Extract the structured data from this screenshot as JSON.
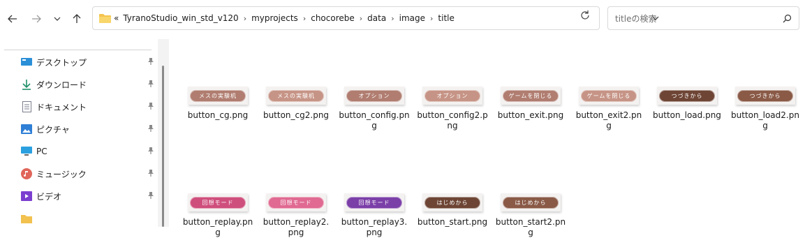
{
  "toolbar": {
    "address_overflow": "«",
    "breadcrumb": [
      "TyranoStudio_win_std_v120",
      "myprojects",
      "chocorebe",
      "data",
      "image",
      "title"
    ],
    "search_placeholder": "titleの検索"
  },
  "sidebar": {
    "items": [
      {
        "label": "デスクトップ",
        "icon": "desktop-icon",
        "color": "#2b8fd8"
      },
      {
        "label": "ダウンロード",
        "icon": "download-icon",
        "color": "#1f8f6a"
      },
      {
        "label": "ドキュメント",
        "icon": "document-icon",
        "color": "#7a7f8c"
      },
      {
        "label": "ピクチャ",
        "icon": "pictures-icon",
        "color": "#2f7fd6"
      },
      {
        "label": "PC",
        "icon": "pc-icon",
        "color": "#2aa0e0"
      },
      {
        "label": "ミュージック",
        "icon": "music-icon",
        "color": "#e0655a"
      },
      {
        "label": "ビデオ",
        "icon": "video-icon",
        "color": "#7b3fd0"
      },
      {
        "label": "",
        "icon": "folder-icon",
        "color": "#f2c14e"
      }
    ]
  },
  "files": [
    {
      "name": "button_cg.png",
      "thumb_text": "メスの実験机",
      "color": "#b07d70"
    },
    {
      "name": "button_cg2.png",
      "thumb_text": "メスの実験机",
      "color": "#c69486"
    },
    {
      "name": "button_config.png",
      "thumb_text": "オプション",
      "color": "#b07d70"
    },
    {
      "name": "button_config2.png",
      "thumb_text": "オプション",
      "color": "#c69486"
    },
    {
      "name": "button_exit.png",
      "thumb_text": "ゲームを閉じる",
      "color": "#b07d70"
    },
    {
      "name": "button_exit2.png",
      "thumb_text": "ゲームを閉じる",
      "color": "#c69486"
    },
    {
      "name": "button_load.png",
      "thumb_text": "つづきから",
      "color": "#6e4535"
    },
    {
      "name": "button_load2.png",
      "thumb_text": "つづきから",
      "color": "#8a5a47"
    },
    {
      "name": "button_replay.png",
      "thumb_text": "回想モード",
      "color": "#cf4f7c"
    },
    {
      "name": "button_replay2.png",
      "thumb_text": "回想モード",
      "color": "#e06a92"
    },
    {
      "name": "button_replay3.png",
      "thumb_text": "回想モード",
      "color": "#7b3fa8"
    },
    {
      "name": "button_start.png",
      "thumb_text": "はじめから",
      "color": "#6e4535"
    },
    {
      "name": "button_start2.png",
      "thumb_text": "はじめから",
      "color": "#8a5a47"
    }
  ]
}
